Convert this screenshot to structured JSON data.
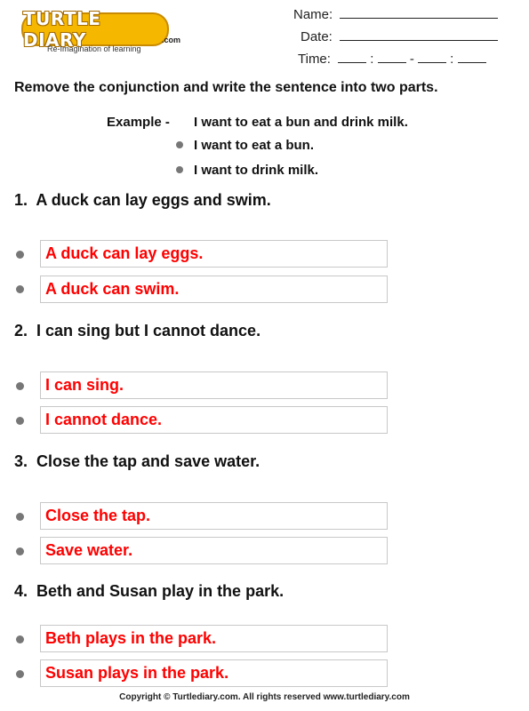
{
  "logo": {
    "brand": "TURTLE DIARY",
    "suffix": ".com",
    "tagline": "Re-Imagination of learning"
  },
  "header": {
    "name_label": "Name:",
    "date_label": "Date:",
    "time_label": "Time:",
    "time_sep1": ":",
    "time_sep2": "-",
    "time_sep3": ":"
  },
  "instruction": "Remove the conjunction and write the sentence into two parts.",
  "example": {
    "label": "Example -",
    "sentence": "I want to eat a bun and drink milk.",
    "parts": [
      "I want to eat a bun.",
      "I want to drink milk."
    ]
  },
  "questions": [
    {
      "number": "1.",
      "text": "A duck can lay eggs and swim.",
      "answers": [
        "A duck can lay eggs.",
        "A duck can swim."
      ]
    },
    {
      "number": "2.",
      "text": "I can sing but I cannot dance.",
      "answers": [
        "I can sing.",
        "I cannot dance."
      ]
    },
    {
      "number": "3.",
      "text": "Close the tap and save water.",
      "answers": [
        "Close the tap.",
        "Save water."
      ]
    },
    {
      "number": "4.",
      "text": "Beth and Susan play in the park.",
      "answers": [
        "Beth plays in the park.",
        "Susan plays in the park."
      ]
    }
  ],
  "footer": "Copyright © Turtlediary.com. All rights reserved  www.turtlediary.com",
  "colors": {
    "answer": "#ff0000",
    "logo": "#f5b700"
  }
}
